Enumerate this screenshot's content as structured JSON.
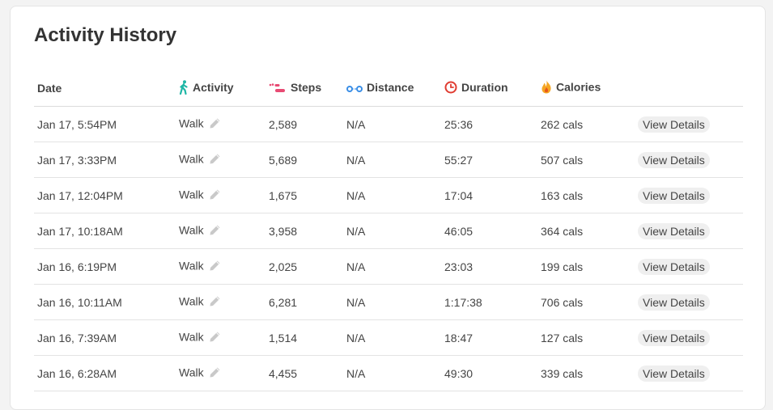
{
  "page": {
    "title": "Activity History"
  },
  "columns": {
    "date": "Date",
    "activity": "Activity",
    "steps": "Steps",
    "distance": "Distance",
    "duration": "Duration",
    "calories": "Calories"
  },
  "icons": {
    "activity": "walking-person-icon",
    "steps": "footprints-icon",
    "distance": "distance-icon",
    "duration": "clock-icon",
    "calories": "flame-icon",
    "edit": "pencil-icon"
  },
  "colors": {
    "activity_icon": "#1fb7a6",
    "steps_icon": "#e84a73",
    "distance_icon": "#3a8ee6",
    "duration_icon": "#e03c31",
    "calories_icon": "#f5a623"
  },
  "rows": [
    {
      "date": "Jan 17, 5:54PM",
      "activity": "Walk",
      "steps": "2,589",
      "distance": "N/A",
      "duration": "25:36",
      "calories": "262 cals",
      "action": "View Details"
    },
    {
      "date": "Jan 17, 3:33PM",
      "activity": "Walk",
      "steps": "5,689",
      "distance": "N/A",
      "duration": "55:27",
      "calories": "507 cals",
      "action": "View Details"
    },
    {
      "date": "Jan 17, 12:04PM",
      "activity": "Walk",
      "steps": "1,675",
      "distance": "N/A",
      "duration": "17:04",
      "calories": "163 cals",
      "action": "View Details"
    },
    {
      "date": "Jan 17, 10:18AM",
      "activity": "Walk",
      "steps": "3,958",
      "distance": "N/A",
      "duration": "46:05",
      "calories": "364 cals",
      "action": "View Details"
    },
    {
      "date": "Jan 16, 6:19PM",
      "activity": "Walk",
      "steps": "2,025",
      "distance": "N/A",
      "duration": "23:03",
      "calories": "199 cals",
      "action": "View Details"
    },
    {
      "date": "Jan 16, 10:11AM",
      "activity": "Walk",
      "steps": "6,281",
      "distance": "N/A",
      "duration": "1:17:38",
      "calories": "706 cals",
      "action": "View Details"
    },
    {
      "date": "Jan 16, 7:39AM",
      "activity": "Walk",
      "steps": "1,514",
      "distance": "N/A",
      "duration": "18:47",
      "calories": "127 cals",
      "action": "View Details"
    },
    {
      "date": "Jan 16, 6:28AM",
      "activity": "Walk",
      "steps": "4,455",
      "distance": "N/A",
      "duration": "49:30",
      "calories": "339 cals",
      "action": "View Details"
    }
  ]
}
